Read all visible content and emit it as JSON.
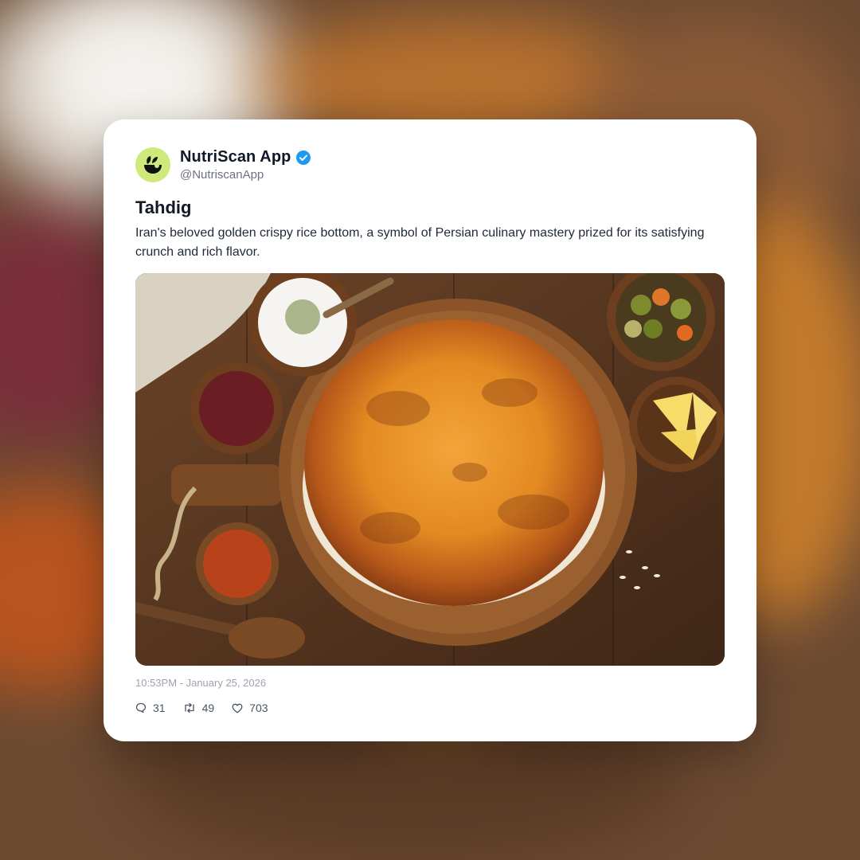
{
  "account": {
    "display_name": "NutriScan App",
    "handle": "@NutriscanApp",
    "verified": true,
    "avatar_color": "#cfe97a"
  },
  "post": {
    "title": "Tahdig",
    "body": "Iran's beloved golden crispy rice bottom, a symbol of Persian culinary mastery prized for its satisfying crunch and rich flavor.",
    "image_icon": "tahdig-photo",
    "timestamp": "10:53PM - January 25, 2026"
  },
  "stats": {
    "replies": "31",
    "reposts": "49",
    "likes": "703"
  },
  "colors": {
    "verified_blue": "#1d9bf0",
    "card_bg": "#ffffff",
    "text_primary": "#111827",
    "text_muted": "#6b7280"
  }
}
